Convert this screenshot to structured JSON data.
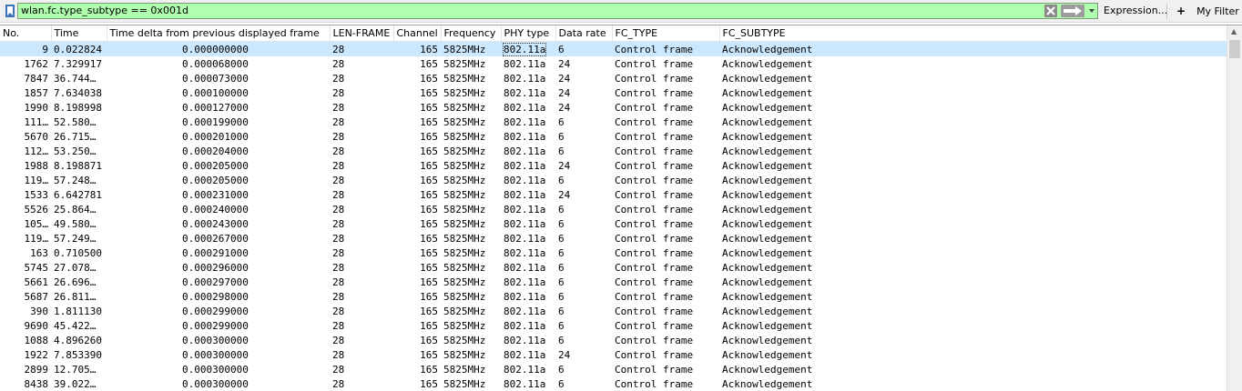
{
  "toolbar": {
    "filter_value": "wlan.fc.type_subtype == 0x001d",
    "expression_label": "Expression...",
    "add_label": "+",
    "myfilter_label": "My Filter",
    "filter_bg": "#afffaf"
  },
  "columns": [
    "No.",
    "Time",
    "Time delta from previous displayed frame",
    "LEN-FRAME",
    "Channel",
    "Frequency",
    "PHY type",
    "Data rate",
    "FC_TYPE",
    "FC_SUBTYPE"
  ],
  "rows": [
    [
      "9",
      "0.022824",
      "0.000000000",
      "28",
      "165",
      "5825MHz",
      "802.11a",
      "6",
      "Control frame",
      "Acknowledgement"
    ],
    [
      "1762",
      "7.329917",
      "0.000068000",
      "28",
      "165",
      "5825MHz",
      "802.11a",
      "24",
      "Control frame",
      "Acknowledgement"
    ],
    [
      "7847",
      "36.744…",
      "0.000073000",
      "28",
      "165",
      "5825MHz",
      "802.11a",
      "24",
      "Control frame",
      "Acknowledgement"
    ],
    [
      "1857",
      "7.634038",
      "0.000100000",
      "28",
      "165",
      "5825MHz",
      "802.11a",
      "24",
      "Control frame",
      "Acknowledgement"
    ],
    [
      "1990",
      "8.198998",
      "0.000127000",
      "28",
      "165",
      "5825MHz",
      "802.11a",
      "24",
      "Control frame",
      "Acknowledgement"
    ],
    [
      "111…",
      "52.580…",
      "0.000199000",
      "28",
      "165",
      "5825MHz",
      "802.11a",
      "6",
      "Control frame",
      "Acknowledgement"
    ],
    [
      "5670",
      "26.715…",
      "0.000201000",
      "28",
      "165",
      "5825MHz",
      "802.11a",
      "6",
      "Control frame",
      "Acknowledgement"
    ],
    [
      "112…",
      "53.250…",
      "0.000204000",
      "28",
      "165",
      "5825MHz",
      "802.11a",
      "6",
      "Control frame",
      "Acknowledgement"
    ],
    [
      "1988",
      "8.198871",
      "0.000205000",
      "28",
      "165",
      "5825MHz",
      "802.11a",
      "24",
      "Control frame",
      "Acknowledgement"
    ],
    [
      "119…",
      "57.248…",
      "0.000205000",
      "28",
      "165",
      "5825MHz",
      "802.11a",
      "6",
      "Control frame",
      "Acknowledgement"
    ],
    [
      "1533",
      "6.642781",
      "0.000231000",
      "28",
      "165",
      "5825MHz",
      "802.11a",
      "24",
      "Control frame",
      "Acknowledgement"
    ],
    [
      "5526",
      "25.864…",
      "0.000240000",
      "28",
      "165",
      "5825MHz",
      "802.11a",
      "6",
      "Control frame",
      "Acknowledgement"
    ],
    [
      "105…",
      "49.580…",
      "0.000243000",
      "28",
      "165",
      "5825MHz",
      "802.11a",
      "6",
      "Control frame",
      "Acknowledgement"
    ],
    [
      "119…",
      "57.249…",
      "0.000267000",
      "28",
      "165",
      "5825MHz",
      "802.11a",
      "6",
      "Control frame",
      "Acknowledgement"
    ],
    [
      "163",
      "0.710500",
      "0.000291000",
      "28",
      "165",
      "5825MHz",
      "802.11a",
      "6",
      "Control frame",
      "Acknowledgement"
    ],
    [
      "5745",
      "27.078…",
      "0.000296000",
      "28",
      "165",
      "5825MHz",
      "802.11a",
      "6",
      "Control frame",
      "Acknowledgement"
    ],
    [
      "5661",
      "26.696…",
      "0.000297000",
      "28",
      "165",
      "5825MHz",
      "802.11a",
      "6",
      "Control frame",
      "Acknowledgement"
    ],
    [
      "5687",
      "26.811…",
      "0.000298000",
      "28",
      "165",
      "5825MHz",
      "802.11a",
      "6",
      "Control frame",
      "Acknowledgement"
    ],
    [
      "390",
      "1.811130",
      "0.000299000",
      "28",
      "165",
      "5825MHz",
      "802.11a",
      "6",
      "Control frame",
      "Acknowledgement"
    ],
    [
      "9690",
      "45.422…",
      "0.000299000",
      "28",
      "165",
      "5825MHz",
      "802.11a",
      "6",
      "Control frame",
      "Acknowledgement"
    ],
    [
      "1088",
      "4.896260",
      "0.000300000",
      "28",
      "165",
      "5825MHz",
      "802.11a",
      "6",
      "Control frame",
      "Acknowledgement"
    ],
    [
      "1922",
      "7.853390",
      "0.000300000",
      "28",
      "165",
      "5825MHz",
      "802.11a",
      "24",
      "Control frame",
      "Acknowledgement"
    ],
    [
      "2899",
      "12.705…",
      "0.000300000",
      "28",
      "165",
      "5825MHz",
      "802.11a",
      "6",
      "Control frame",
      "Acknowledgement"
    ],
    [
      "8438",
      "39.022…",
      "0.000300000",
      "28",
      "165",
      "5825MHz",
      "802.11a",
      "6",
      "Control frame",
      "Acknowledgement"
    ]
  ],
  "selected_row": 0,
  "sorted_column": 2
}
